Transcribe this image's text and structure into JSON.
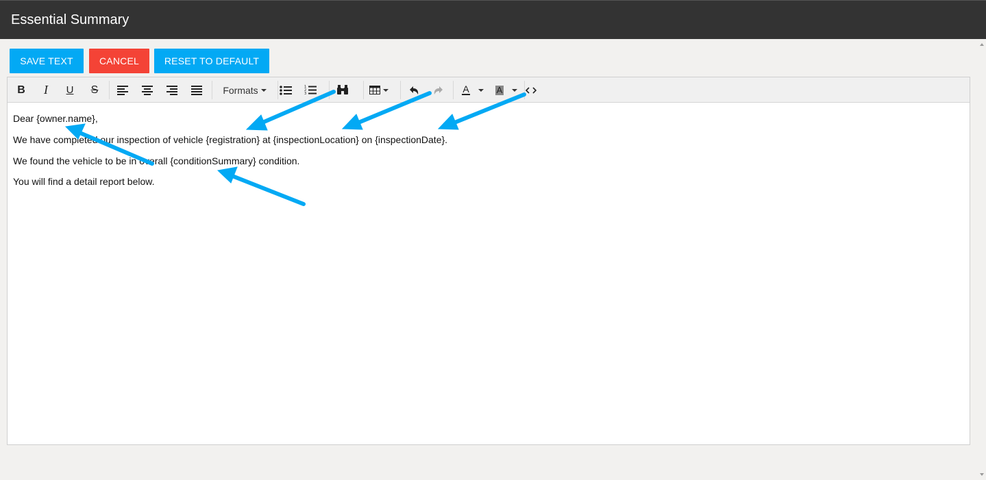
{
  "window": {
    "title": "Essential Summary"
  },
  "actions": {
    "save_label": "SAVE TEXT",
    "cancel_label": "CANCEL",
    "reset_label": "RESET TO DEFAULT"
  },
  "toolbar": {
    "formats_label": "Formats",
    "icons": [
      "bold-icon",
      "italic-icon",
      "underline-icon",
      "strikethrough-icon",
      "align-left-icon",
      "align-center-icon",
      "align-right-icon",
      "align-justify-icon",
      "bullet-list-icon",
      "numbered-list-icon",
      "find-replace-icon",
      "table-icon",
      "undo-icon",
      "redo-icon",
      "text-color-icon",
      "background-color-icon",
      "source-code-icon"
    ]
  },
  "editor": {
    "lines": [
      "Dear {owner.name},",
      "We have completed our inspection of vehicle {registration} at {inspectionLocation} on {inspectionDate}.",
      "We found the vehicle to be in overall {conditionSummary} condition.",
      "You will find a detail report below."
    ]
  },
  "colors": {
    "titlebar": "#333333",
    "primary": "#03a9f4",
    "danger": "#f44336",
    "annotation_arrow": "#03a9f4"
  }
}
